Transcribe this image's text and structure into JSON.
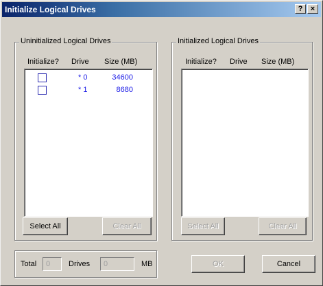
{
  "window": {
    "title": "Initialize Logical Drives",
    "help_glyph": "?",
    "close_glyph": "×"
  },
  "uninitialized": {
    "title": "Uninitialized Logical Drives",
    "headers": {
      "initialize": "Initialize?",
      "drive": "Drive",
      "size": "Size (MB)"
    },
    "rows": [
      {
        "checked": false,
        "drive": "* 0",
        "size": "34600"
      },
      {
        "checked": false,
        "drive": "* 1",
        "size": "8680"
      }
    ],
    "select_all_label": "Select All",
    "clear_all_label": "Clear All"
  },
  "initialized": {
    "title": "Initialized Logical Drives",
    "headers": {
      "initialize": "Initialize?",
      "drive": "Drive",
      "size": "Size (MB)"
    },
    "rows": [],
    "select_all_label": "Select All",
    "clear_all_label": "Clear All"
  },
  "totals": {
    "total_label": "Total",
    "drives_value": "0",
    "drives_label": "Drives",
    "mb_value": "0",
    "mb_label": "MB"
  },
  "buttons": {
    "ok_label": "OK",
    "cancel_label": "Cancel"
  },
  "colors": {
    "title_start": "#0a246a",
    "title_end": "#a6caf0",
    "row_text": "#1a1ae6",
    "face": "#d4d0c8"
  }
}
